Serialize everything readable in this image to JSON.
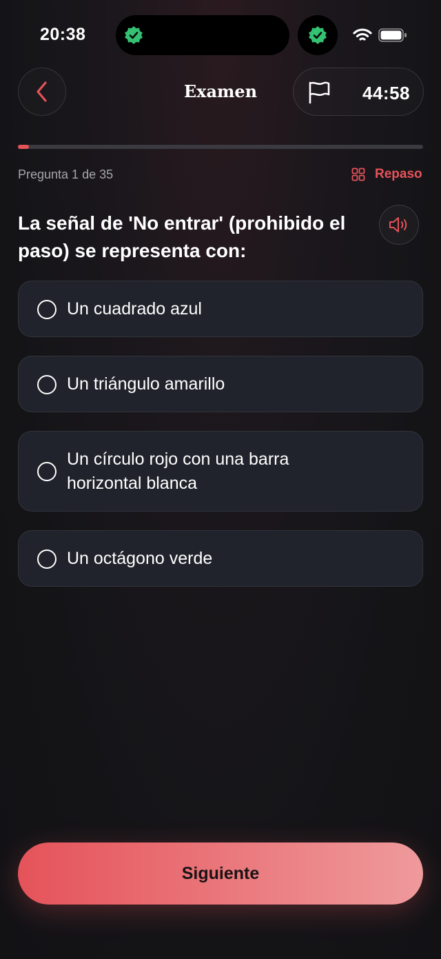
{
  "status_bar": {
    "time": "20:38"
  },
  "header": {
    "title": "Examen",
    "timer": "44:58"
  },
  "progress": {
    "fraction": 0.028
  },
  "question": {
    "counter": "Pregunta 1 de 35",
    "review_label": "Repaso",
    "text": "La señal de 'No entrar' (prohibido el paso) se representa con:"
  },
  "options": [
    {
      "label": "Un cuadrado azul"
    },
    {
      "label": "Un triángulo amarillo"
    },
    {
      "label": "Un círculo rojo con una barra horizontal blanca"
    },
    {
      "label": "Un octágono verde"
    }
  ],
  "footer": {
    "next_label": "Siguiente"
  },
  "colors": {
    "accent": "#e5535a",
    "card": "#20232b",
    "verified": "#34c172"
  }
}
